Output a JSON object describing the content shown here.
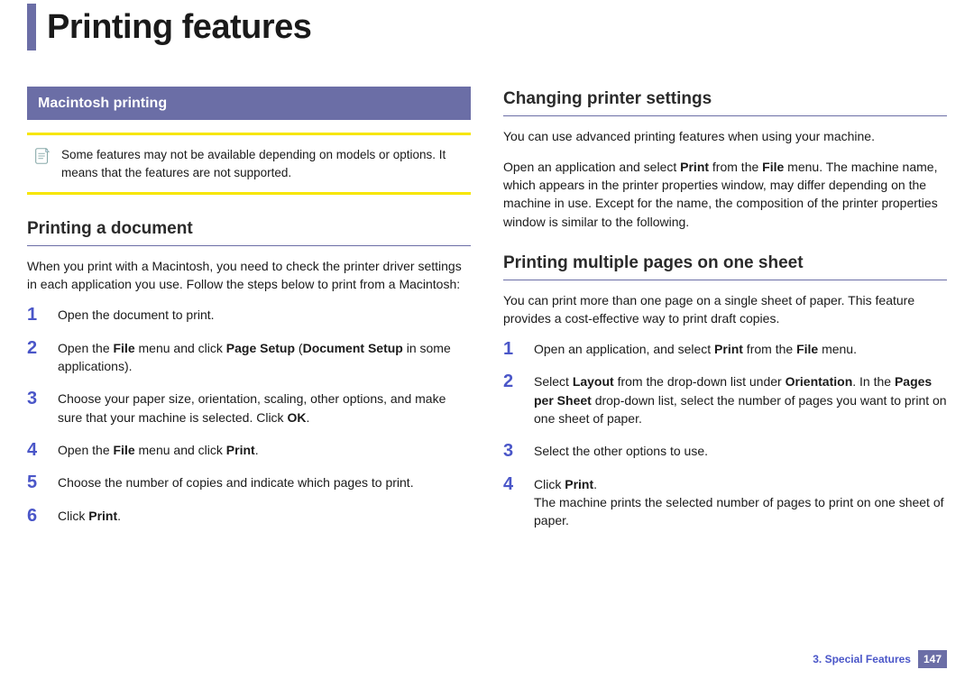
{
  "title": "Printing features",
  "footer": {
    "chapter": "3.  Special Features",
    "page": "147"
  },
  "left": {
    "section_head": "Macintosh printing",
    "note": "Some features may not be available depending on models or options. It means that the features are not supported.",
    "sub1": "Printing a document",
    "intro": "When you print with a Macintosh, you need to check the printer driver settings in each application you use. Follow the steps below to print from a Macintosh:",
    "steps": {
      "s1": "Open the document to print.",
      "s2a": "Open the ",
      "s2b": "File",
      "s2c": " menu and click ",
      "s2d": "Page Setup",
      "s2e": " (",
      "s2f": "Document Setup",
      "s2g": " in some applications).",
      "s3a": "Choose your paper size, orientation, scaling, other options, and make sure that your machine is selected. Click ",
      "s3b": "OK",
      "s3c": ".",
      "s4a": "Open the ",
      "s4b": "File",
      "s4c": " menu and click ",
      "s4d": "Print",
      "s4e": ".",
      "s5": "Choose the number of copies and indicate which pages to print.",
      "s6a": "Click ",
      "s6b": "Print",
      "s6c": "."
    }
  },
  "right": {
    "sub1": "Changing printer settings",
    "p1": "You can use advanced printing features when using your machine.",
    "p2a": "Open an application and select ",
    "p2b": "Print",
    "p2c": " from the ",
    "p2d": "File",
    "p2e": " menu. The machine name, which appears in the printer properties window, may differ depending on the machine in use. Except for the name, the composition of the printer properties window is similar to the following.",
    "sub2": "Printing multiple pages on one sheet",
    "p3": "You can print more than one page on a single sheet of paper. This feature provides a cost-effective way to print draft copies.",
    "steps": {
      "s1a": "Open an application, and select ",
      "s1b": "Print",
      "s1c": " from the ",
      "s1d": "File",
      "s1e": " menu.",
      "s2a": "Select ",
      "s2b": "Layout",
      "s2c": " from the drop-down list under ",
      "s2d": "Orientation",
      "s2e": ". In the ",
      "s2f": "Pages per Sheet",
      "s2g": " drop-down list, select the number of pages you want to print on one sheet of paper.",
      "s3": "Select the other options to use.",
      "s4a": "Click ",
      "s4b": "Print",
      "s4c": ".",
      "s4d": "The machine prints the selected number of pages to print on one sheet of paper."
    }
  }
}
